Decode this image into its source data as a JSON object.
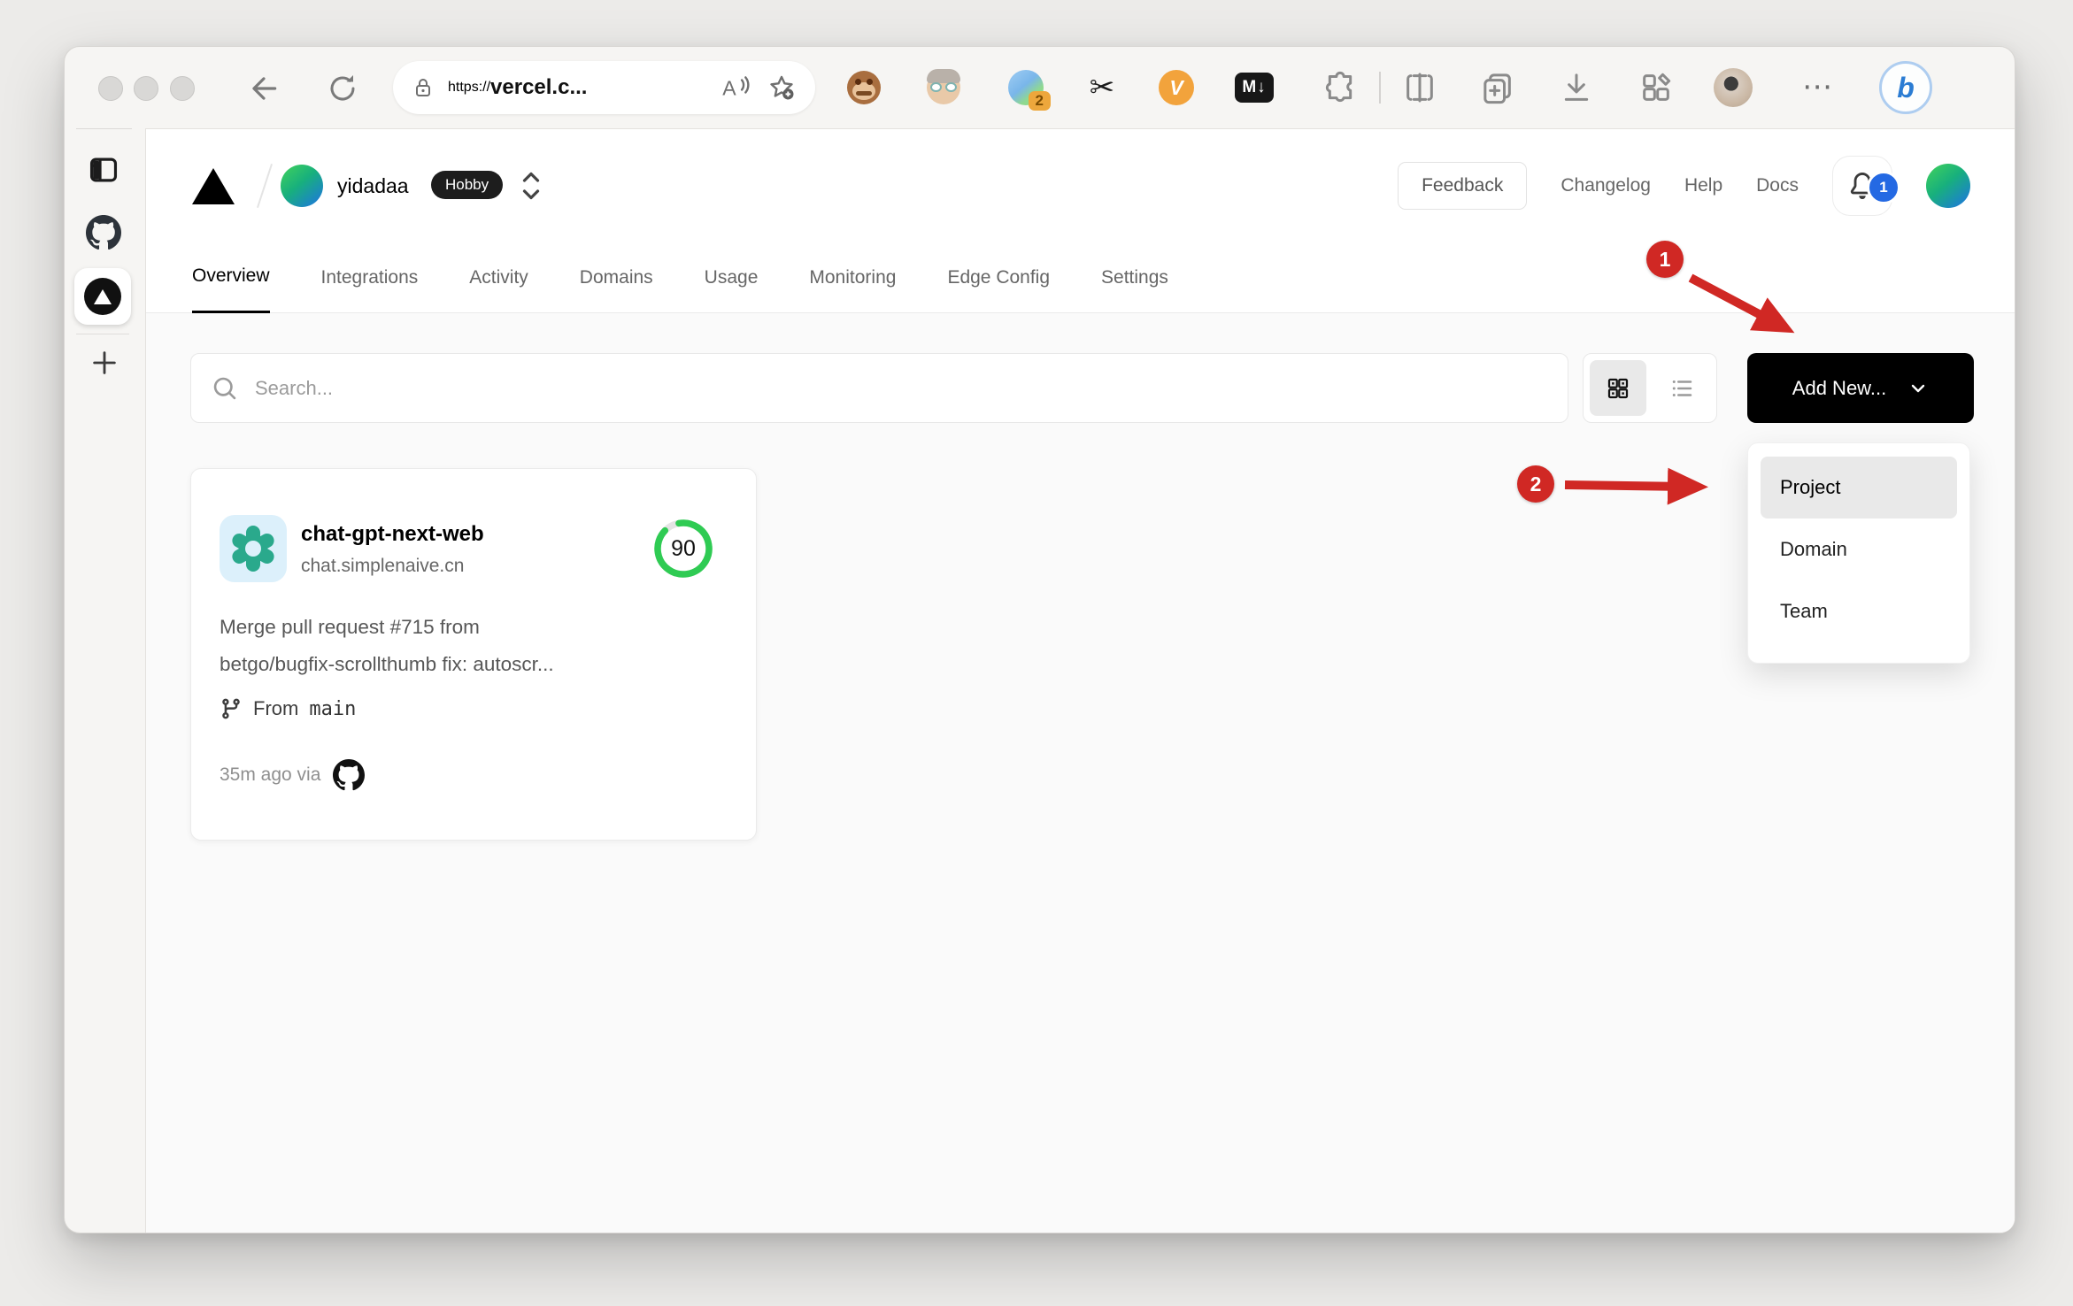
{
  "browser": {
    "url_scheme": "https://",
    "url_host": "vercel.c...",
    "tab_group_badge": "2",
    "markdown_icon_label": "M↓",
    "orange_v_label": "V",
    "scissors_glyph": "✂",
    "bing_label": "b",
    "more_glyph": "⋯"
  },
  "vercel_header": {
    "team_name": "yidadaa",
    "plan_badge": "Hobby",
    "feedback_label": "Feedback",
    "links": [
      "Changelog",
      "Help",
      "Docs"
    ],
    "notification_count": "1"
  },
  "nav_tabs": [
    {
      "label": "Overview",
      "active": true
    },
    {
      "label": "Integrations",
      "active": false
    },
    {
      "label": "Activity",
      "active": false
    },
    {
      "label": "Domains",
      "active": false
    },
    {
      "label": "Usage",
      "active": false
    },
    {
      "label": "Monitoring",
      "active": false
    },
    {
      "label": "Edge Config",
      "active": false
    },
    {
      "label": "Settings",
      "active": false
    }
  ],
  "projects_toolbar": {
    "search_placeholder": "Search...",
    "add_new_label": "Add New..."
  },
  "add_new_dropdown": {
    "items": [
      "Project",
      "Domain",
      "Team"
    ],
    "highlighted_item": "Project"
  },
  "project_card": {
    "name": "chat-gpt-next-web",
    "domain": "chat.simplenaive.cn",
    "score": "90",
    "commit_message_line1": "Merge pull request #715 from",
    "commit_message_line2": "betgo/bugfix-scrollthumb fix: autoscr...",
    "branch_prefix": "From",
    "branch_name": "main",
    "deployed_time": "35m ago via"
  },
  "annotations": {
    "step1": "1",
    "step2": "2"
  },
  "colors": {
    "accent_green": "#2fcb53",
    "annotation_red": "#d02824",
    "badge_blue": "#2469e3",
    "button_black": "#000000"
  }
}
